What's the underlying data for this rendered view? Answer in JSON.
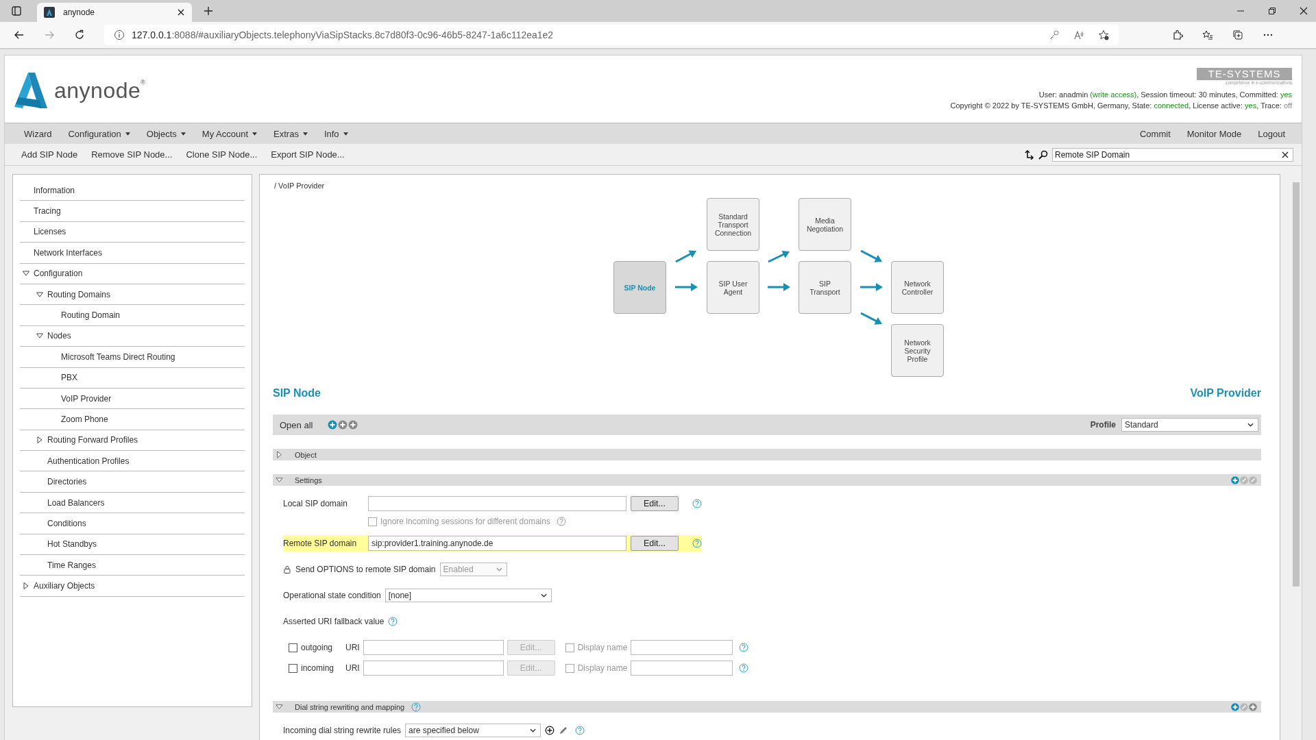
{
  "browser": {
    "tab_title": "anynode",
    "url_host": "127.0.0.1",
    "url_path": ":8088/#auxiliaryObjects.telephonyViaSipStacks.8c7d80f3-0c96-46b5-8247-1a6c112ea1e2"
  },
  "header": {
    "logo": "anynode$^{®}$",
    "brand": "TE-SYSTEMS",
    "tagline": "competence in e-communications",
    "status_lines": [
      [
        {
          "text": "User: anadmin "
        },
        {
          "text": "(write access)",
          "color": "#1e8c1e"
        },
        {
          "text": ", Session timeout: 30 minutes, Committed: "
        },
        {
          "text": "yes",
          "color": "#1e8c1e"
        }
      ],
      [
        {
          "text": "Copyright © 2022 by TE-SYSTEMS GmbH, Germany, State: "
        },
        {
          "text": "connected",
          "color": "#1e8c1e"
        },
        {
          "text": ", License active: "
        },
        {
          "text": "yes",
          "color": "#1e8c1e"
        },
        {
          "text": ", Trace: "
        },
        {
          "text": "off",
          "color": "#888888"
        }
      ]
    ]
  },
  "menu": [
    {
      "label": "Wizard",
      "dropdown": false
    },
    {
      "label": "Configuration",
      "dropdown": true
    },
    {
      "label": "Objects",
      "dropdown": true
    },
    {
      "label": "My Account",
      "dropdown": true
    },
    {
      "label": "Extras",
      "dropdown": true
    },
    {
      "label": "Info",
      "dropdown": true
    }
  ],
  "menu_right": [
    "Commit",
    "Monitor Mode",
    "Logout"
  ],
  "toolbar": [
    "Add SIP Node",
    "Remove SIP Node...",
    "Clone SIP Node...",
    "Export SIP Node..."
  ],
  "search": {
    "value": "Remote SIP Domain"
  },
  "sidebar": {
    "items": [
      {
        "label": "Information"
      },
      {
        "label": "Tracing"
      },
      {
        "label": "Licenses"
      },
      {
        "label": "Network Interfaces"
      },
      {
        "label": "Configuration",
        "expanded": true,
        "children": [
          {
            "label": "Routing Domains",
            "expanded": true,
            "children": [
              {
                "label": "Routing Domain"
              }
            ]
          },
          {
            "label": "Nodes",
            "expanded": true,
            "children": [
              {
                "label": "Microsoft Teams Direct Routing"
              },
              {
                "label": "PBX"
              },
              {
                "label": "VoIP Provider"
              },
              {
                "label": "Zoom Phone"
              }
            ]
          },
          {
            "label": "Routing Forward Profiles",
            "expanded": false
          },
          {
            "label": "Authentication Profiles"
          },
          {
            "label": "Directories"
          },
          {
            "label": "Load Balancers"
          },
          {
            "label": "Conditions"
          },
          {
            "label": "Hot Standbys"
          },
          {
            "label": "Time Ranges"
          }
        ]
      },
      {
        "label": "Auxiliary Objects",
        "expanded": false
      }
    ]
  },
  "breadcrumb": "/ VoIP Provider",
  "diagram": {
    "nodes": [
      {
        "label": "SIP Node",
        "selected": true
      },
      {
        "label": "Standard Transport Connection",
        "selected": false
      },
      {
        "label": "SIP User Agent",
        "selected": false
      },
      {
        "label": "Media Negotiation",
        "selected": false
      },
      {
        "label": "SIP Transport",
        "selected": false
      },
      {
        "label": "Network Controller",
        "selected": false
      },
      {
        "label": "Network Security Profile",
        "selected": false
      }
    ]
  },
  "title_left": "SIP Node",
  "title_right": "VoIP Provider",
  "open_all": {
    "label": "Open all",
    "tools": [
      {
        "active": true
      },
      {
        "active": false
      },
      {
        "active": false
      }
    ],
    "profile_label": "Profile",
    "profile_value": "Standard"
  },
  "sections": [
    {
      "title": "Object",
      "expanded": false,
      "help": false
    },
    {
      "title": "Settings",
      "expanded": true,
      "help": false,
      "tools": [
        {
          "kind": "add",
          "active": true
        },
        {
          "kind": "edit",
          "active": false
        },
        {
          "kind": "edit",
          "active": false
        }
      ],
      "rows": [
        {
          "kind": "text_edit",
          "label": "Local SIP domain",
          "button": "Edit...",
          "highlighted": false
        },
        {
          "kind": "checkbox",
          "label": "Ignore incoming sessions for different domains",
          "checked": false,
          "disabled": true
        },
        {
          "kind": "text_edit",
          "label": "Remote SIP domain",
          "value": "sip:provider1.training.anynode.de",
          "button": "Edit...",
          "highlighted": true
        },
        {
          "kind": "select",
          "label": "Send OPTIONS to remote SIP domain",
          "locked": true,
          "value": "Enabled",
          "disabled": true
        },
        {
          "kind": "select",
          "label": "Operational state condition",
          "locked": false,
          "value": "[none]",
          "disabled": false
        },
        {
          "kind": "heading",
          "label": "Asserted URI fallback value"
        },
        {
          "kind": "uri",
          "label": "outgoing",
          "checked": false,
          "uri_label": "URI",
          "button": "Edit...",
          "display_label": "Display name",
          "display_checked": false
        },
        {
          "kind": "uri",
          "label": "incoming",
          "checked": false,
          "uri_label": "URI",
          "button": "Edit...",
          "display_label": "Display name",
          "display_checked": false
        }
      ]
    },
    {
      "title": "Dial string rewriting and mapping",
      "expanded": true,
      "help": true,
      "tools": [
        {
          "kind": "add",
          "active": true
        },
        {
          "kind": "edit",
          "active": false
        },
        {
          "kind": "add",
          "active": false
        }
      ],
      "rows": [
        {
          "kind": "select_actions",
          "label": "Incoming dial string rewrite rules",
          "value": "are specified below",
          "disabled": false
        }
      ]
    }
  ]
}
